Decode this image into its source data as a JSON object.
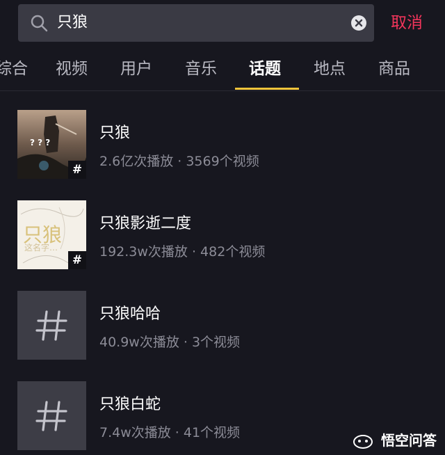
{
  "search": {
    "query": "只狼",
    "cancel_label": "取消"
  },
  "tabs": [
    {
      "label": "综合"
    },
    {
      "label": "视频"
    },
    {
      "label": "用户"
    },
    {
      "label": "音乐"
    },
    {
      "label": "话题"
    },
    {
      "label": "地点"
    },
    {
      "label": "商品"
    }
  ],
  "active_tab": "话题",
  "results": [
    {
      "title": "只狼",
      "meta": "2.6亿次播放 · 3569个视频",
      "thumb": "image",
      "badge": "#"
    },
    {
      "title": "只狼影逝二度",
      "meta": "192.3w次播放 · 482个视频",
      "thumb": "image",
      "badge": "#"
    },
    {
      "title": "只狼哈哈",
      "meta": "40.9w次播放 · 3个视频",
      "thumb": "hashtag",
      "badge": "#"
    },
    {
      "title": "只狼白蛇",
      "meta": "7.4w次播放 · 41个视频",
      "thumb": "hashtag",
      "badge": "#"
    }
  ],
  "thumb1_text": "? ? ?",
  "thumb2_text": "只狼",
  "watermark": "悟空问答",
  "colors": {
    "background": "#17171f",
    "cancel": "#f2355b",
    "indicator": "#f5c53b",
    "search_bg": "#3a3a44"
  }
}
